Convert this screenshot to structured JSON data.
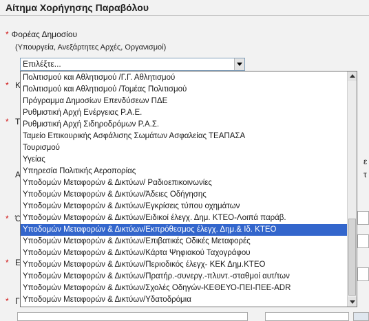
{
  "page": {
    "title": "Αίτημα Χορήγησης Παραβόλου"
  },
  "field": {
    "required_mark": "*",
    "label": "Φορέας Δημοσίου",
    "hint": "(Υπουργεία, Ανεξάρτητες Αρχές, Οργανισμοί)",
    "selected_value": "Επιλέξτε..."
  },
  "background": {
    "glyphs": [
      "*",
      "Κ",
      "*",
      "Τ",
      "Α",
      "*",
      "Ό",
      "*",
      "Ε",
      "*",
      "Γ",
      "ε",
      "τ"
    ]
  },
  "dropdown": {
    "options": [
      "Πολιτισμού και Αθλητισμού /Γ.Γ. Αθλητισμού",
      "Πολιτισμού και Αθλητισμού /Τομέας Πολιτισμού",
      "Πρόγραμμα Δημοσίων Επενδύσεων ΠΔΕ",
      "Ρυθμιστική Αρχή Ενέργειας Ρ.Α.Ε.",
      "Ρυθμιστική Αρχή Σιδηροδρόμων Ρ.Α.Σ.",
      "Ταμείο Επικουρικής Ασφάλισης Σωμάτων Ασφαλείας ΤΕΑΠΑΣΑ",
      "Τουρισμού",
      "Υγείας",
      "Υπηρεσία Πολιτικής Αεροπορίας",
      "Υποδομών Μεταφορών & Δικτύων/ Ραδιοεπικοινωνίες",
      "Υποδομών Μεταφορών & Δικτύων/Άδειες Οδήγησης",
      "Υποδομών Μεταφορών & Δικτύων/Εγκρίσεις τύπου οχημάτων",
      "Υποδομών Μεταφορών & Δικτύων/Ειδικοί έλεγχ. Δημ. ΚΤΕΟ-Λοιπά παράβ.",
      "Υποδομών Μεταφορών & Δικτύων/Εκπρόθεσμος έλεγχ. Δημ.& Ιδ. ΚΤΕΟ",
      "Υποδομών Μεταφορών & Δικτύων/Επιβατικές Οδικές Μεταφορές",
      "Υποδομών Μεταφορών & Δικτύων/Κάρτα Ψηφιακού Ταχογράφου",
      "Υποδομών Μεταφορών & Δικτύων/Περιοδικός έλεγχ- ΚΕΚ Δημ.ΚΤΕΟ",
      "Υποδομών Μεταφορών & Δικτύων/Πρατήρ.-συνεργ.-πλυντ.-σταθμοί αυτ/των",
      "Υποδομών Μεταφορών & Δικτύων/Σχολές Οδηγών-ΚΕΘΕΥΟ-ΠΕΙ-ΠΕΕ-ADR",
      "Υποδομών Μεταφορών & Δικτύων/Υδατοδρόμια"
    ],
    "highlighted_option": "Υποδομών Μεταφορών & Δικτύων/Εκπρόθεσμος έλεγχ. Δημ.& Ιδ. ΚΤΕΟ"
  },
  "colors": {
    "highlight": "#3366cc",
    "required": "#d01010"
  }
}
